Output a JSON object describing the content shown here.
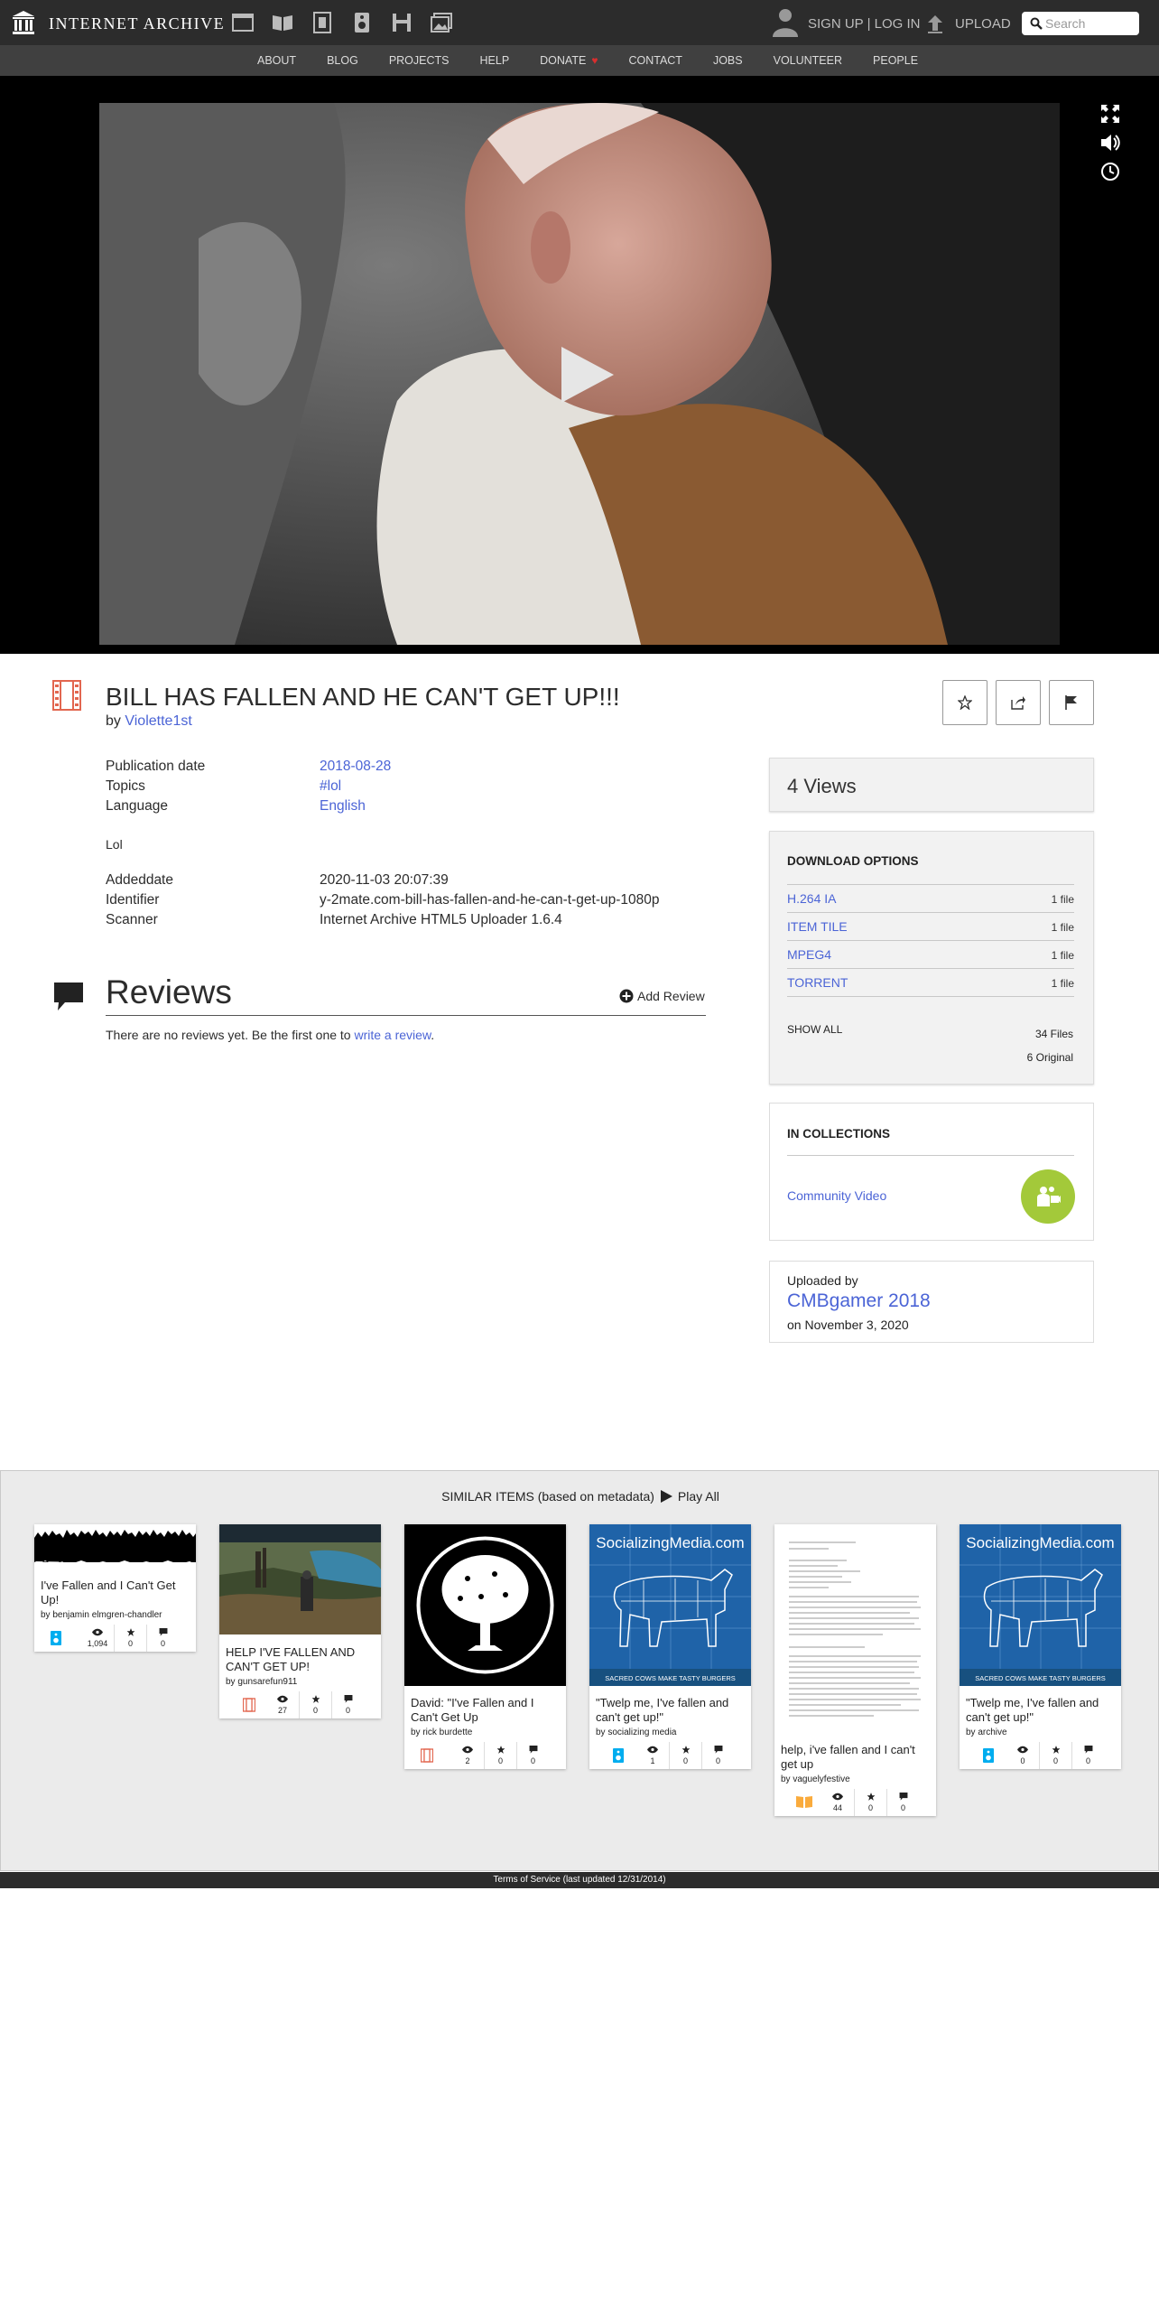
{
  "header": {
    "brand": "INTERNET ARCHIVE",
    "auth_text": "SIGN UP | LOG IN",
    "upload_label": "UPLOAD",
    "search_placeholder": "Search"
  },
  "subnav": {
    "items": [
      "ABOUT",
      "BLOG",
      "PROJECTS",
      "HELP",
      "DONATE",
      "CONTACT",
      "JOBS",
      "VOLUNTEER",
      "PEOPLE"
    ]
  },
  "item": {
    "title": "BILL HAS FALLEN AND HE CAN'T GET UP!!!",
    "by_prefix": "by",
    "creator": "Violette1st"
  },
  "metadata": {
    "pubdate_label": "Publication date",
    "pubdate": "2018-08-28",
    "topics_label": "Topics",
    "topics": "#lol",
    "language_label": "Language",
    "language": "English",
    "description": "Lol",
    "addeddate_label": "Addeddate",
    "addeddate": "2020-11-03 20:07:39",
    "identifier_label": "Identifier",
    "identifier": "y-2mate.com-bill-has-fallen-and-he-can-t-get-up-1080p",
    "scanner_label": "Scanner",
    "scanner": "Internet Archive HTML5 Uploader 1.6.4"
  },
  "reviews": {
    "title": "Reviews",
    "add_label": "Add Review",
    "empty_text": "There are no reviews yet. Be the first one to",
    "write_link": "write a review",
    "period": "."
  },
  "views": "4 Views",
  "downloads": {
    "title": "DOWNLOAD OPTIONS",
    "rows": [
      {
        "format": "H.264 IA",
        "count": "1 file"
      },
      {
        "format": "ITEM TILE",
        "count": "1 file"
      },
      {
        "format": "MPEG4",
        "count": "1 file"
      },
      {
        "format": "TORRENT",
        "count": "1 file"
      }
    ],
    "show_all": "SHOW ALL",
    "files": "34 Files",
    "original": "6 Original"
  },
  "collections": {
    "title": "IN COLLECTIONS",
    "items": [
      "Community Video"
    ]
  },
  "uploader": {
    "label": "Uploaded by",
    "name": "CMBgamer 2018",
    "date": "on November 3, 2020"
  },
  "similar": {
    "heading": "SIMILAR ITEMS (based on metadata)",
    "play_all": "Play All",
    "items": [
      {
        "title": "I've Fallen and I Can't Get Up!",
        "by": "by benjamin elmgren-chandler",
        "mediatype": "audio-icon",
        "views": "1,094",
        "favs": "0",
        "reviews": "0"
      },
      {
        "title": "HELP I'VE FALLEN AND CAN'T GET UP!",
        "by": "by gunsarefun911",
        "mediatype": "film-icon",
        "views": "27",
        "favs": "0",
        "reviews": "0"
      },
      {
        "title": "David: \"I've Fallen and I Can't Get Up",
        "by": "by rick burdette",
        "mediatype": "film-icon",
        "views": "2",
        "favs": "0",
        "reviews": "0"
      },
      {
        "title": "\"Twelp me, I've fallen and can't get up!\"",
        "by": "by socializing media",
        "mediatype": "audio-icon",
        "views": "1",
        "favs": "0",
        "reviews": "0"
      },
      {
        "title": "help, i've fallen and I can't get up",
        "by": "by vaguelyfestive",
        "mediatype": "book-icon",
        "views": "44",
        "favs": "0",
        "reviews": "0"
      },
      {
        "title": "\"Twelp me, I've fallen and can't get up!\"",
        "by": "by archive",
        "mediatype": "audio-icon",
        "views": "0",
        "favs": "0",
        "reviews": "0"
      }
    ],
    "thumb_banner_text": "SocializingMedia.com",
    "thumb_footer_text": "SACRED COWS MAKE TASTY BURGERS"
  },
  "footer": "Terms of Service (last updated 12/31/2014)",
  "colors": {
    "topbar": "#2c2c2c",
    "subnav": "#404040",
    "link": "#4b64d6",
    "collection_badge": "#a3c93a",
    "film_icon": "#e2664f",
    "audio_icon": "#00adef",
    "book_icon": "#faab3c"
  }
}
